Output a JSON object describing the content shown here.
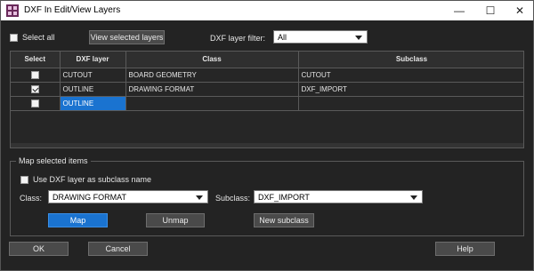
{
  "window": {
    "title": "DXF In Edit/View Layers",
    "controls": {
      "minimize": "—",
      "maximize": "☐",
      "close": "✕"
    }
  },
  "top": {
    "select_all_label": "Select all",
    "select_all_checked": false,
    "view_selected_label": "View selected layers",
    "filter_label": "DXF layer filter:",
    "filter_value": "All"
  },
  "table": {
    "headers": [
      "Select",
      "DXF layer",
      "Class",
      "Subclass"
    ],
    "rows": [
      {
        "checked": false,
        "layer": "CUTOUT",
        "class": "BOARD GEOMETRY",
        "subclass": "CUTOUT"
      },
      {
        "checked": true,
        "layer": "OUTLINE",
        "class": "DRAWING FORMAT",
        "subclass": "DXF_IMPORT"
      },
      {
        "checked": false,
        "layer": "OUTLINE",
        "class": "",
        "subclass": ""
      }
    ]
  },
  "map_group": {
    "title": "Map selected items",
    "use_layer_label": "Use DXF layer as subclass name",
    "use_layer_checked": false,
    "class_label": "Class:",
    "class_value": "DRAWING FORMAT",
    "subclass_label": "Subclass:",
    "subclass_value": "DXF_IMPORT",
    "map_label": "Map",
    "unmap_label": "Unmap",
    "new_subclass_label": "New subclass"
  },
  "footer": {
    "ok_label": "OK",
    "cancel_label": "Cancel",
    "help_label": "Help"
  },
  "colors": {
    "accent": "#1a73d0",
    "background": "#232323",
    "titlebar": "#ffffff"
  }
}
